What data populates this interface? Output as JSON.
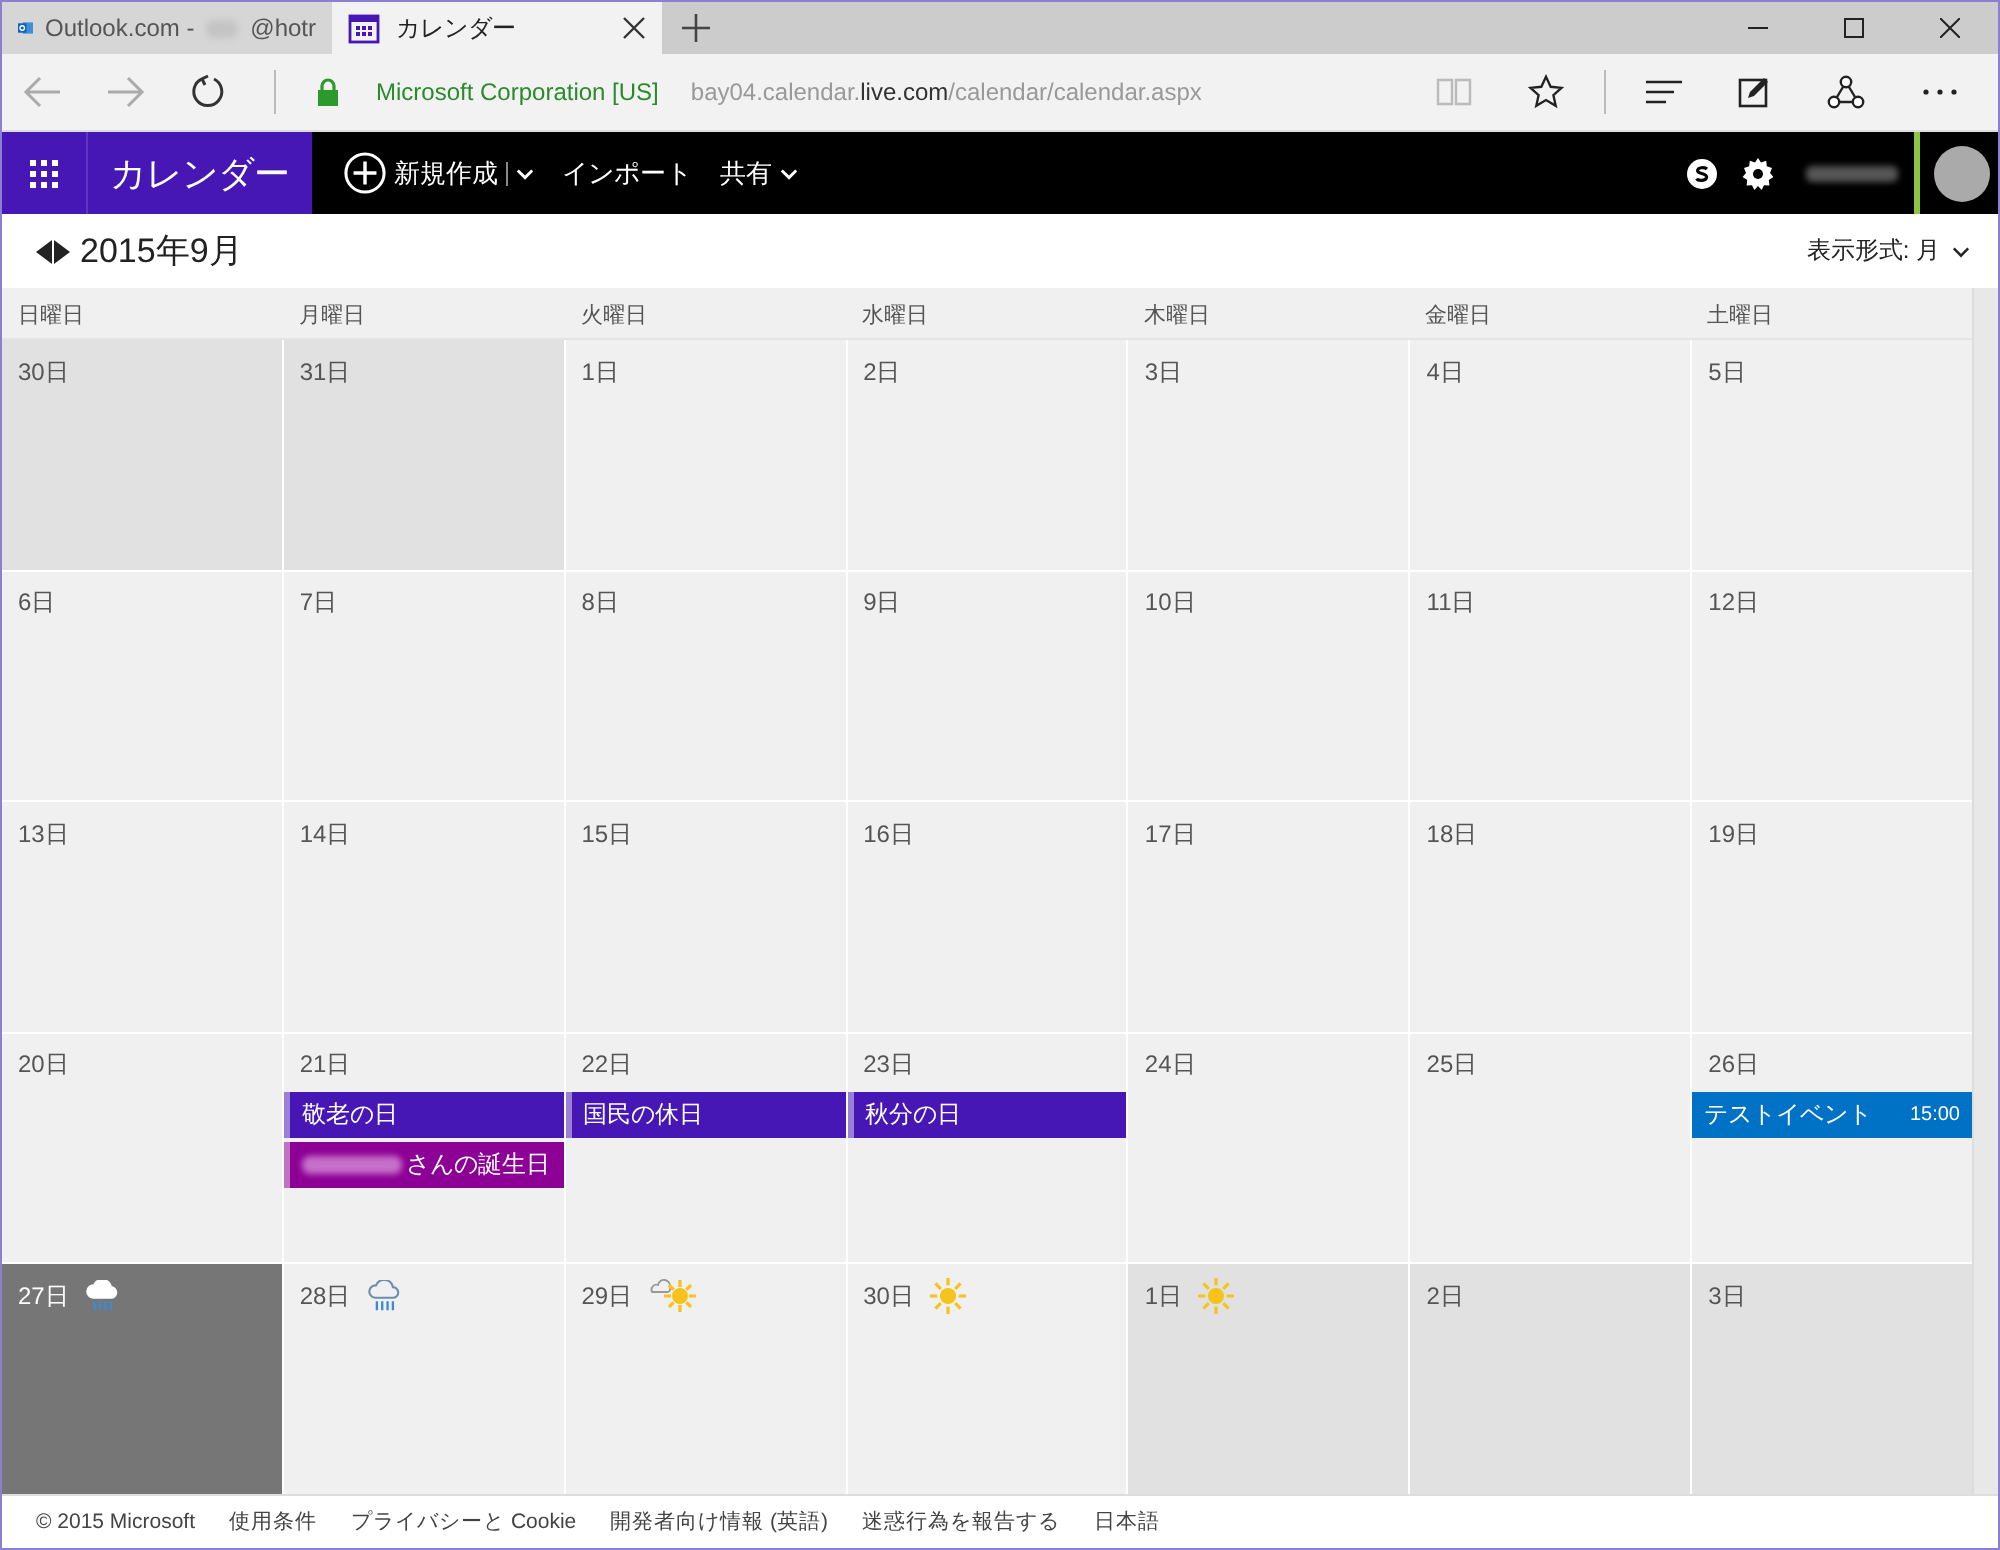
{
  "browser": {
    "tabs": [
      {
        "kind": "outlook",
        "title": "Outlook.com -",
        "suffix": "@hotr",
        "selected": false
      },
      {
        "kind": "calendar",
        "title": "カレンダー",
        "selected": true
      }
    ],
    "address": {
      "identity": "Microsoft Corporation [US]",
      "url_prefix": "bay04.calendar.",
      "url_domain": "live.com",
      "url_path": "/calendar/calendar.aspx"
    }
  },
  "app": {
    "title": "カレンダー",
    "commands": [
      {
        "label": "新規作成",
        "kind": "new"
      },
      {
        "label": "インポート",
        "kind": "plain"
      },
      {
        "label": "共有",
        "kind": "menu"
      }
    ]
  },
  "month": {
    "title": "2015年9月",
    "view_label": "表示形式: 月"
  },
  "weekdays": [
    "日曜日",
    "月曜日",
    "火曜日",
    "水曜日",
    "木曜日",
    "金曜日",
    "土曜日"
  ],
  "weeks": [
    [
      {
        "label": "30日",
        "kind": "outside"
      },
      {
        "label": "31日",
        "kind": "outside"
      },
      {
        "label": "1日",
        "kind": "inside"
      },
      {
        "label": "2日",
        "kind": "inside"
      },
      {
        "label": "3日",
        "kind": "inside"
      },
      {
        "label": "4日",
        "kind": "inside"
      },
      {
        "label": "5日",
        "kind": "inside"
      }
    ],
    [
      {
        "label": "6日",
        "kind": "inside"
      },
      {
        "label": "7日",
        "kind": "inside"
      },
      {
        "label": "8日",
        "kind": "inside"
      },
      {
        "label": "9日",
        "kind": "inside"
      },
      {
        "label": "10日",
        "kind": "inside"
      },
      {
        "label": "11日",
        "kind": "inside"
      },
      {
        "label": "12日",
        "kind": "inside"
      }
    ],
    [
      {
        "label": "13日",
        "kind": "inside"
      },
      {
        "label": "14日",
        "kind": "inside"
      },
      {
        "label": "15日",
        "kind": "inside"
      },
      {
        "label": "16日",
        "kind": "inside"
      },
      {
        "label": "17日",
        "kind": "inside"
      },
      {
        "label": "18日",
        "kind": "inside"
      },
      {
        "label": "19日",
        "kind": "inside"
      }
    ],
    [
      {
        "label": "20日",
        "kind": "inside"
      },
      {
        "label": "21日",
        "kind": "inside",
        "events": [
          {
            "kind": "all_day",
            "title": "敬老の日",
            "color": "#4617b4"
          },
          {
            "kind": "birthday",
            "title": "さんの誕生日",
            "color": "#8c0095"
          }
        ]
      },
      {
        "label": "22日",
        "kind": "inside",
        "events": [
          {
            "kind": "all_day",
            "title": "国民の休日",
            "color": "#4617b4"
          }
        ]
      },
      {
        "label": "23日",
        "kind": "inside",
        "events": [
          {
            "kind": "all_day",
            "title": "秋分の日",
            "color": "#4617b4"
          }
        ]
      },
      {
        "label": "24日",
        "kind": "inside"
      },
      {
        "label": "25日",
        "kind": "inside"
      },
      {
        "label": "26日",
        "kind": "inside",
        "events": [
          {
            "kind": "timed",
            "title": "テストイベント",
            "time": "15:00",
            "color": "#0072c6"
          }
        ]
      }
    ],
    [
      {
        "label": "27日",
        "kind": "today",
        "weather": {
          "kind": "rain"
        }
      },
      {
        "label": "28日",
        "kind": "inside",
        "weather": {
          "kind": "rain"
        }
      },
      {
        "label": "29日",
        "kind": "inside",
        "weather": {
          "kind": "cloud_sun"
        }
      },
      {
        "label": "30日",
        "kind": "inside",
        "weather": {
          "kind": "sun"
        }
      },
      {
        "label": "1日",
        "kind": "outside",
        "weather": {
          "kind": "sun"
        }
      },
      {
        "label": "2日",
        "kind": "outside"
      },
      {
        "label": "3日",
        "kind": "outside"
      }
    ]
  ],
  "footer": [
    "© 2015 Microsoft",
    "使用条件",
    "プライバシーと Cookie",
    "開発者向け情報 (英語)",
    "迷惑行為を報告する",
    "日本語"
  ]
}
